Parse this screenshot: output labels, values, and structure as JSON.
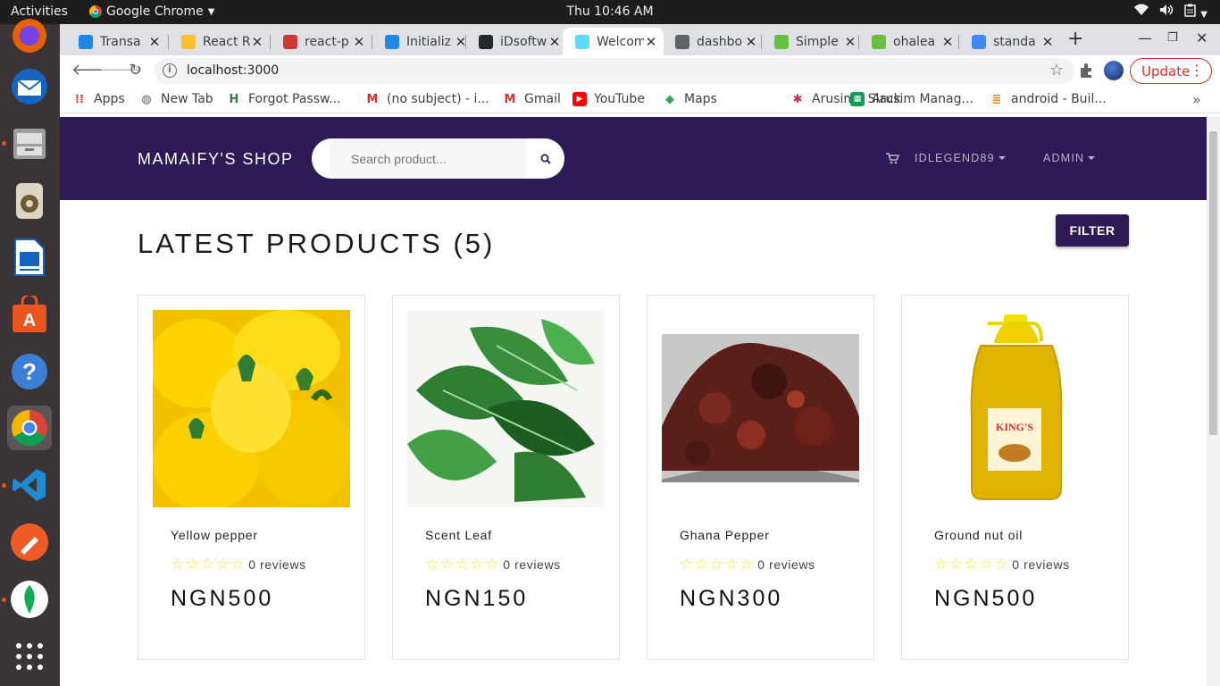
{
  "system": {
    "activities": "Activities",
    "app_name": "Google Chrome",
    "clock": "Thu 10:46 AM"
  },
  "tabs": [
    {
      "title": "Transa",
      "icon": "doc-icon",
      "color": "#1e88e5"
    },
    {
      "title": "React R",
      "icon": "emoji-icon",
      "color": "#fbc02d"
    },
    {
      "title": "react-p",
      "icon": "npm-icon",
      "color": "#cb3837"
    },
    {
      "title": "Initializ",
      "icon": "doc-icon",
      "color": "#1e88e5"
    },
    {
      "title": "iDsoftw",
      "icon": "github-icon",
      "color": "#24292e"
    },
    {
      "title": "Welcom",
      "icon": "react-icon",
      "color": "#61dafb"
    },
    {
      "title": "dashbo",
      "icon": "globe-icon",
      "color": "#5f6368"
    },
    {
      "title": "Simple",
      "icon": "leaf-icon",
      "color": "#6abf40"
    },
    {
      "title": "ohalea",
      "icon": "leaf-icon",
      "color": "#6abf40"
    },
    {
      "title": "standa",
      "icon": "google-icon",
      "color": "#4285f4"
    }
  ],
  "browser": {
    "url": "localhost:3000",
    "update_label": "Update"
  },
  "bookmarks": [
    {
      "label": "Apps",
      "icon": "apps-grid-icon"
    },
    {
      "label": "New Tab",
      "icon": "globe-icon"
    },
    {
      "label": "Forgot Passw...",
      "icon": "hh-icon"
    },
    {
      "label": "(no subject) - i...",
      "icon": "gmail-icon"
    },
    {
      "label": "Gmail",
      "icon": "gmail-icon"
    },
    {
      "label": "YouTube",
      "icon": "youtube-icon"
    },
    {
      "label": "Maps",
      "icon": "maps-icon"
    },
    {
      "label": "Arusim | Slack",
      "icon": "slack-icon"
    },
    {
      "label": "Arusim Manag...",
      "icon": "sheets-icon"
    },
    {
      "label": "android - Buil...",
      "icon": "stackoverflow-icon"
    }
  ],
  "shop": {
    "brand": "MAMAIFY'S SHOP",
    "search_placeholder": "Search product...",
    "user_menu": "IDLEGEND89",
    "admin_menu": "ADMIN",
    "heading": "LATEST PRODUCTS (5)",
    "filter_label": "FILTER",
    "products": [
      {
        "name": "Yellow pepper",
        "reviews": "0 reviews",
        "price": "NGN500",
        "rating": 0
      },
      {
        "name": "Scent Leaf",
        "reviews": "0 reviews",
        "price": "NGN150",
        "rating": 0
      },
      {
        "name": "Ghana Pepper",
        "reviews": "0 reviews",
        "price": "NGN300",
        "rating": 0
      },
      {
        "name": "Ground nut oil",
        "reviews": "0 reviews",
        "price": "NGN500",
        "rating": 0
      }
    ]
  }
}
